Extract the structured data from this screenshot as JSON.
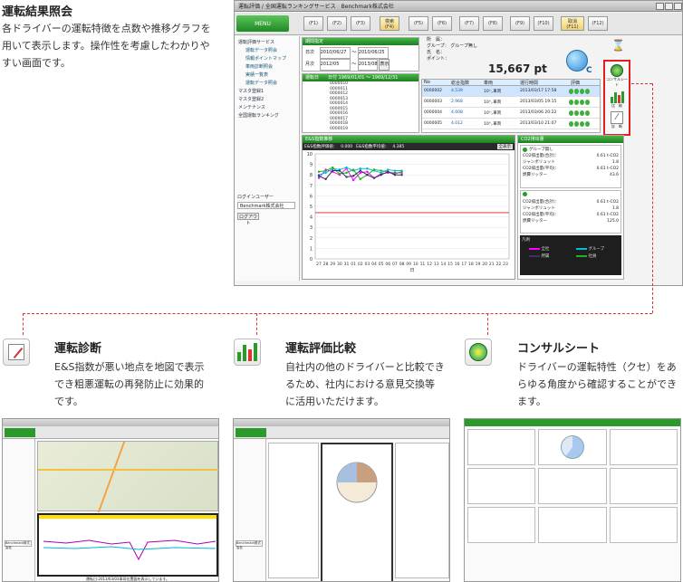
{
  "sections": {
    "result": {
      "heading": "運転結果照会",
      "description": [
        "各ドライバーの運転特徴を点数や推移グラフを",
        "用いて表示します。操作性を考慮したわかりや",
        "すい画面です。"
      ]
    },
    "diagnosis": {
      "heading": "運転診断",
      "description": [
        "E&S指数が悪い地点を地図で表示",
        "でき粗悪運転の再発防止に効果的",
        "です。"
      ]
    },
    "comparison": {
      "heading": "運転評価比較",
      "description": [
        "自社内の他のドライバーと比較でき",
        "るため、社内における意見交換等",
        "に活用いただけます。"
      ]
    },
    "consult": {
      "heading": "コンサルシート",
      "description": [
        "ドライバーの運転特性（クセ）をあ",
        "らゆる角度から確認することができ",
        "ます。"
      ]
    }
  },
  "app": {
    "title": "運転評価 / 全国運転ランキングサービス　Benchmark株式会社",
    "menu_label": "MENU",
    "tabs": [
      "(F1)",
      "(F2)",
      "(F3)",
      "検索\n(F4)",
      "(F5)",
      "(F6)",
      "(F7)",
      "(F8)",
      "(F9)",
      "(F10)",
      "取消\n(F11)",
      "(F12)"
    ],
    "sidebar": {
      "header": "運転評価サービス",
      "items": [
        "運転データ照会",
        "情報ポイントマップ",
        "車両診断照会",
        "実績一覧表",
        "運転データ照会"
      ],
      "groups": [
        "マスタ登録1",
        "マスタ登録2",
        "メンテナンス",
        "全国運転ランキング"
      ],
      "login_label": "ログインユーザー",
      "login_user": "Benchmark株式会社",
      "logout": "ログアウト"
    },
    "search": {
      "label": "期間指定",
      "from_label": "日次",
      "from_date": "2010/06/27",
      "to_date": "2010/06/25",
      "month_label": "月次",
      "from_month": "2012/05",
      "to_month": "2013/08",
      "display_button": "表示"
    },
    "driver": {
      "office_label": "所　属：",
      "group_label": "グループ：",
      "group_value": "グループ無し",
      "name_label": "氏　名：",
      "point_label": "ポイント：",
      "points": "15,667 pt",
      "rank": "C"
    },
    "list_headers": [
      "No",
      "総合指数",
      "車両",
      "運行時間",
      "評価"
    ],
    "list_rows": [
      {
        "no": "0000002",
        "score": "4.539",
        "car": "10㌧車両",
        "time": "2013/03/17 17:58"
      },
      {
        "no": "0000003",
        "score": "2.968",
        "car": "10㌧車両",
        "time": "2013/03/05 19:15"
      },
      {
        "no": "0000004",
        "score": "4.608",
        "car": "10㌧車両",
        "time": "2013/03/06 20:22"
      },
      {
        "no": "0000005",
        "score": "4.012",
        "car": "10㌧車両",
        "time": "2013/03/10 21:07"
      }
    ],
    "summary_header": "運転日　　日付 1969/01/01 ～ 1969/12/31",
    "summary_rows": [
      "0000010",
      "0000011",
      "0000012",
      "0000013",
      "0000014",
      "0000015",
      "0000016",
      "0000017",
      "0000018",
      "0000019"
    ],
    "chart": {
      "title": "E&S指数推移",
      "legend_a": "E&S指数評価値：",
      "value_a": "0.000",
      "legend_b": "E&S指数平均値：",
      "value_b": "4.385",
      "button": "全表示",
      "xlabel": "日"
    },
    "co2": {
      "title": "CO2排出量",
      "group_label": "グループ無し",
      "lines": [
        {
          "label": "CO2排出量(合計)：",
          "value": "0.61 t-CO2"
        },
        {
          "label": "ジャンボリュット",
          "value": "1.8"
        },
        {
          "label": "CO2排出量(平均)：",
          "value": "0.61 t-CO2"
        },
        {
          "label": "燃費リッター",
          "value": "43.6"
        }
      ],
      "lines2": [
        {
          "label": "CO2排出量(合計)：",
          "value": "0.61 t-CO2"
        },
        {
          "label": "ジャンボリュット",
          "value": "1.8"
        },
        {
          "label": "CO2排出量(平均)：",
          "value": "0.61 t-CO2"
        },
        {
          "label": "燃費リッター",
          "value": "125.0"
        }
      ],
      "legend_title": "凡例",
      "legend": [
        "全社",
        "グループ",
        "所属",
        "社員"
      ]
    },
    "right_buttons": {
      "consult_label": "コンサルシート",
      "compare_label": "比　較",
      "diag_label": "診　断"
    }
  },
  "chart_data": {
    "type": "line",
    "x": [
      1,
      2,
      3,
      4,
      5,
      6,
      7,
      8,
      9,
      10,
      11,
      12,
      13
    ],
    "x_ticks": [
      "27",
      "28",
      "29",
      "30",
      "31",
      "01",
      "02",
      "03",
      "04",
      "05",
      "06",
      "07",
      "08",
      "09",
      "10",
      "11",
      "12",
      "13",
      "14",
      "15",
      "16",
      "17",
      "18",
      "19",
      "20",
      "21",
      "22",
      "23"
    ],
    "y_ticks": [
      "0",
      "1",
      "2",
      "3",
      "4",
      "5",
      "6",
      "7",
      "8",
      "9",
      "10"
    ],
    "ylim": [
      0,
      10
    ],
    "series": [
      {
        "values": [
          7.7,
          8.5,
          8.3,
          8.0,
          8.6,
          7.5,
          8.2,
          8.3,
          7.7,
          8.1,
          8.2,
          8.2,
          8.2
        ],
        "color": "#ff00ff"
      },
      {
        "values": [
          8.0,
          8.2,
          8.6,
          8.5,
          8.7,
          8.4,
          8.6,
          8.6,
          8.4,
          8.2,
          8.5,
          8.4,
          8.4
        ],
        "color": "#00bcd4"
      },
      {
        "values": [
          8.3,
          8.4,
          8.7,
          8.1,
          8.2,
          8.5,
          7.6,
          8.0,
          8.5,
          8.4,
          8.3,
          8.1,
          8.3
        ],
        "color": "#20b020"
      },
      {
        "values": [
          7.9,
          7.6,
          8.4,
          8.4,
          7.8,
          7.9,
          8.4,
          8.0,
          7.7,
          8.0,
          8.3,
          8.0,
          8.0
        ],
        "color": "#333366"
      }
    ],
    "reference_line": 4.4
  },
  "thumbs": {
    "diag_footer": "運転日:2013/03/03車両位置図を表示しています。",
    "diag_login": "Benchmark株式会社",
    "compare_login": "Benchmark株式会社"
  }
}
